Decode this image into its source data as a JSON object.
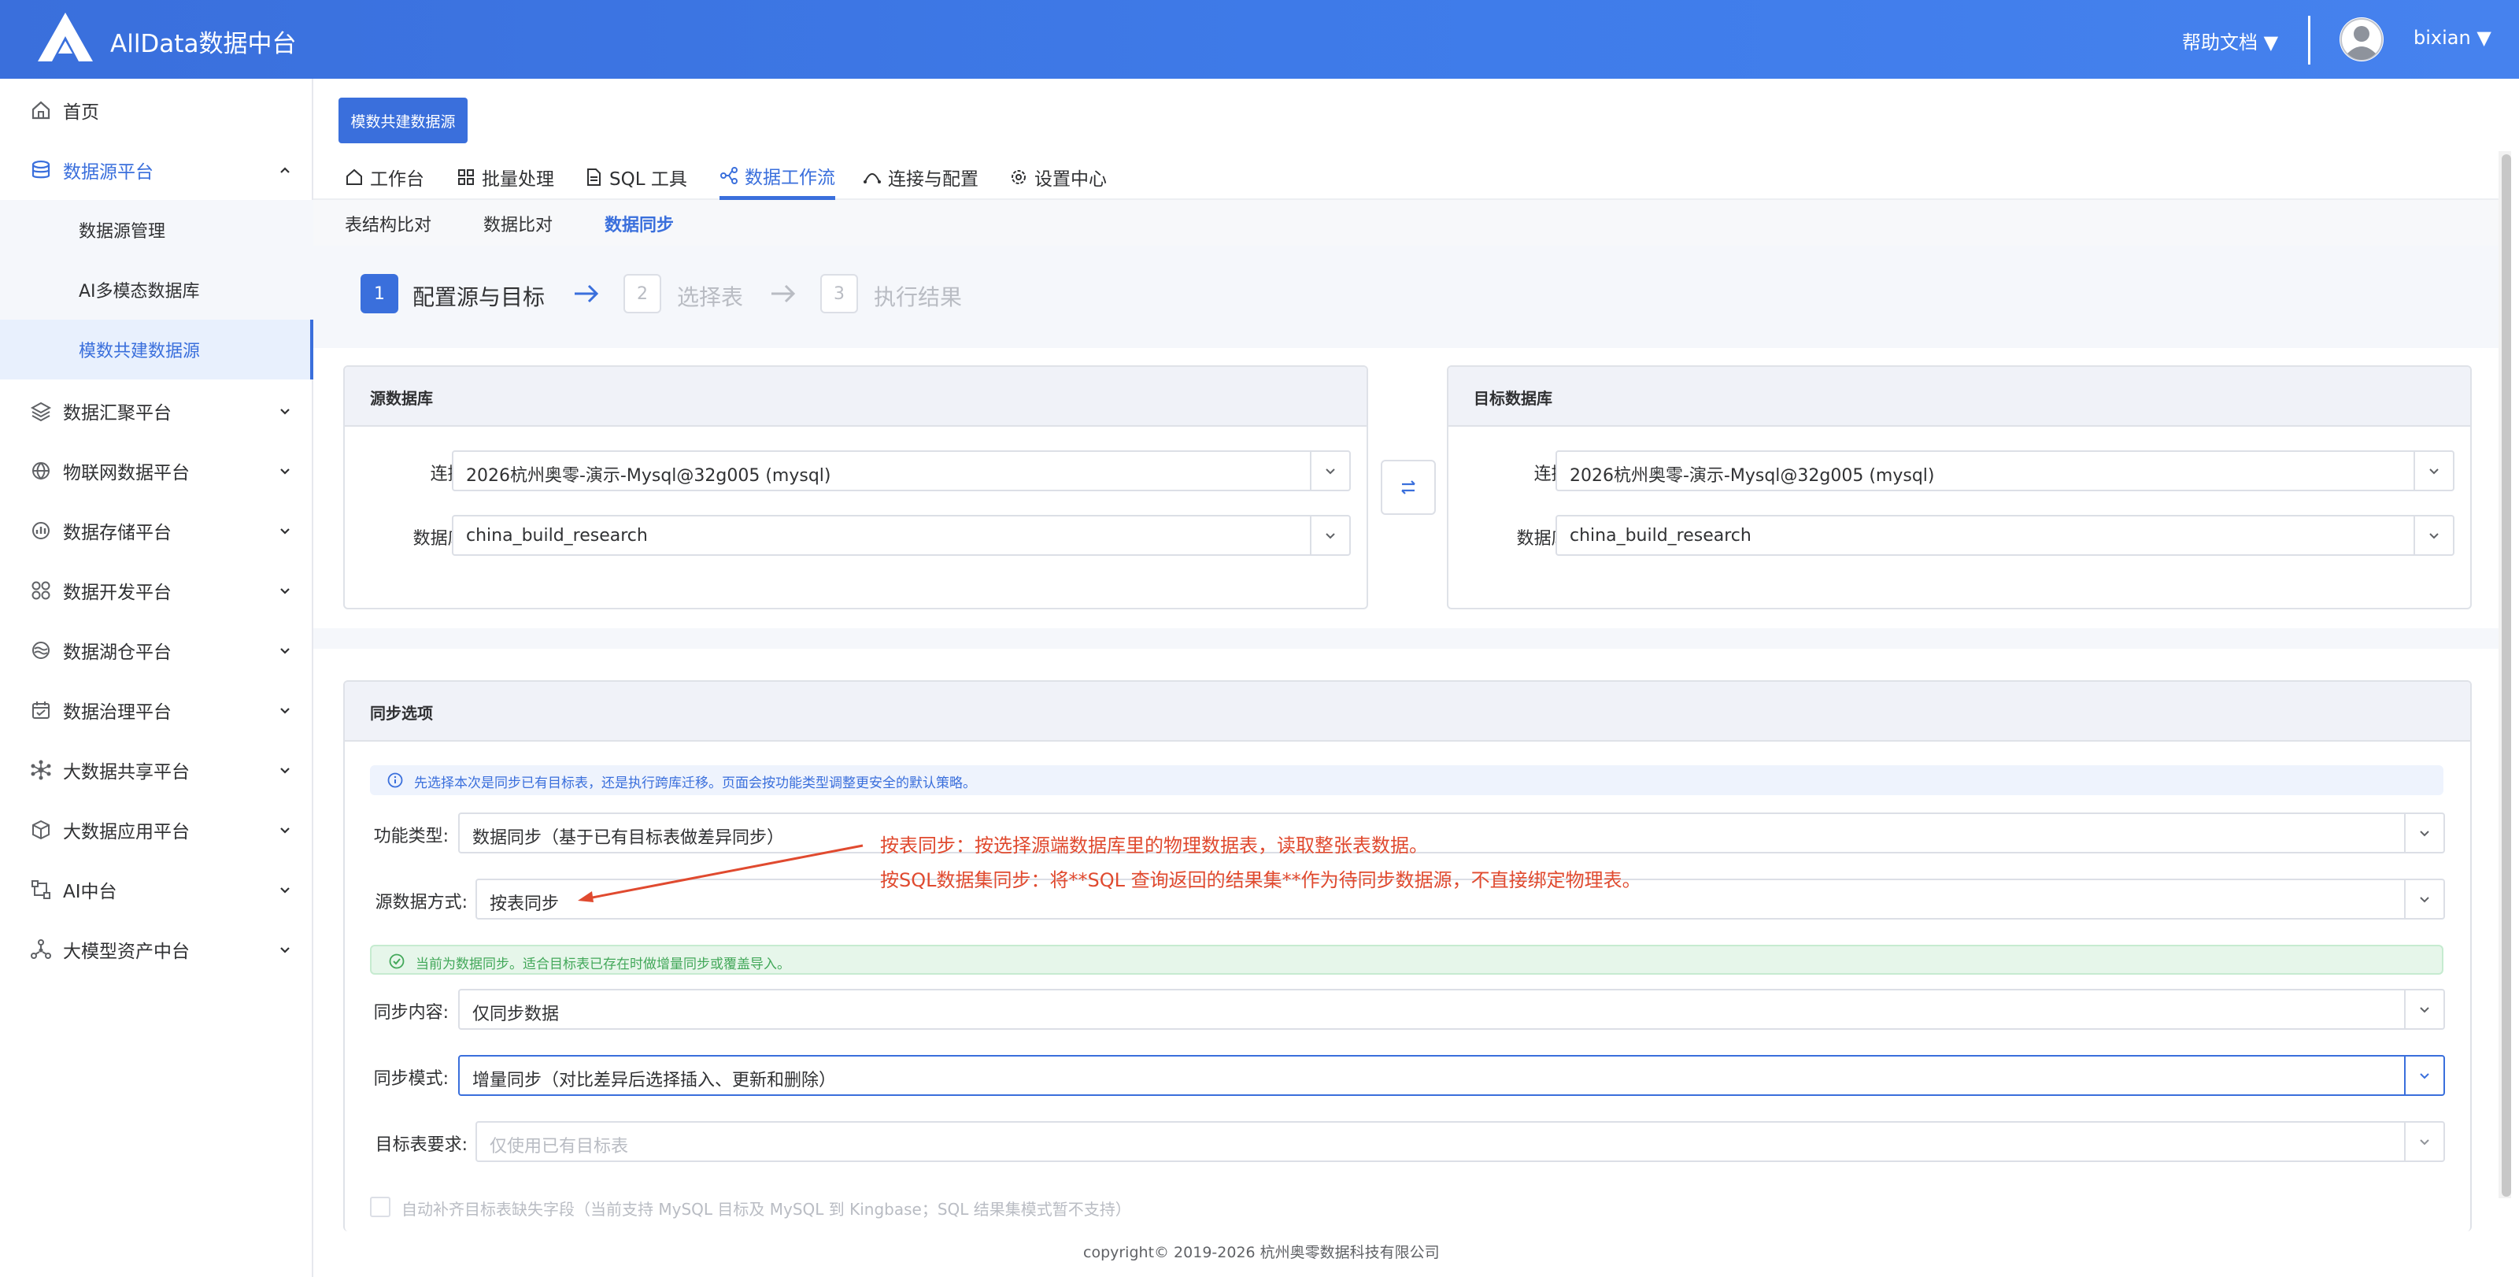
{
  "header": {
    "app_title": "AllData数据中台",
    "help_label": "帮助文档 ▼",
    "username": "bixian ▼"
  },
  "sidebar": {
    "items": [
      {
        "label": "首页"
      },
      {
        "label": "数据源平台"
      },
      {
        "label": "数据源管理"
      },
      {
        "label": "AI多模态数据库"
      },
      {
        "label": "模数共建数据源"
      },
      {
        "label": "数据汇聚平台"
      },
      {
        "label": "物联网数据平台"
      },
      {
        "label": "数据存储平台"
      },
      {
        "label": "数据开发平台"
      },
      {
        "label": "数据湖仓平台"
      },
      {
        "label": "数据治理平台"
      },
      {
        "label": "大数据共享平台"
      },
      {
        "label": "大数据应用平台"
      },
      {
        "label": "AI中台"
      },
      {
        "label": "大模型资产中台"
      }
    ]
  },
  "page": {
    "top_button": "模数共建数据源",
    "tabs": [
      {
        "label": "工作台"
      },
      {
        "label": "批量处理"
      },
      {
        "label": "SQL 工具"
      },
      {
        "label": "数据工作流"
      },
      {
        "label": "连接与配置"
      },
      {
        "label": "设置中心"
      }
    ],
    "subtabs": [
      {
        "label": "表结构比对"
      },
      {
        "label": "数据比对"
      },
      {
        "label": "数据同步"
      }
    ],
    "steps": [
      {
        "num": "1",
        "label": "配置源与目标"
      },
      {
        "num": "2",
        "label": "选择表"
      },
      {
        "num": "3",
        "label": "执行结果"
      }
    ]
  },
  "source_panel": {
    "title": "源数据库",
    "conn_label": "连接:",
    "conn_value": "2026杭州奥零-演示-Mysql@32g005 (mysql)",
    "db_label": "数据库:",
    "db_value": "china_build_research"
  },
  "target_panel": {
    "title": "目标数据库",
    "conn_label": "连接:",
    "conn_value": "2026杭州奥零-演示-Mysql@32g005 (mysql)",
    "db_label": "数据库:",
    "db_value": "china_build_research"
  },
  "sync_options": {
    "title": "同步选项",
    "info_text": "先选择本次是同步已有目标表，还是执行跨库迁移。页面会按功能类型调整更安全的默认策略。",
    "func_type_label": "功能类型:",
    "func_type_value": "数据同步（基于已有目标表做差异同步）",
    "source_mode_label": "源数据方式:",
    "source_mode_value": "按表同步",
    "success_text": "当前为数据同步。适合目标表已存在时做增量同步或覆盖导入。",
    "content_label": "同步内容:",
    "content_value": "仅同步数据",
    "mode_label": "同步模式:",
    "mode_value": "增量同步（对比差异后选择插入、更新和删除）",
    "target_req_label": "目标表要求:",
    "target_req_placeholder": "仅使用已有目标表",
    "checkbox_label": "自动补齐目标表缺失字段（当前支持 MySQL 目标及 MySQL 到 Kingbase；SQL 结果集模式暂不支持）"
  },
  "annotations": {
    "line1": "按表同步：按选择源端数据库里的物理数据表，读取整张表数据。",
    "line2": "按SQL数据集同步：将**SQL 查询返回的结果集**作为待同步数据源，不直接绑定物理表。"
  },
  "footer": {
    "copyright": "copyright© 2019-2026 杭州奥零数据科技有限公司"
  },
  "colors": {
    "brand": "#3a6fdc",
    "annotation": "#e04a2f",
    "success": "#43a85a"
  }
}
